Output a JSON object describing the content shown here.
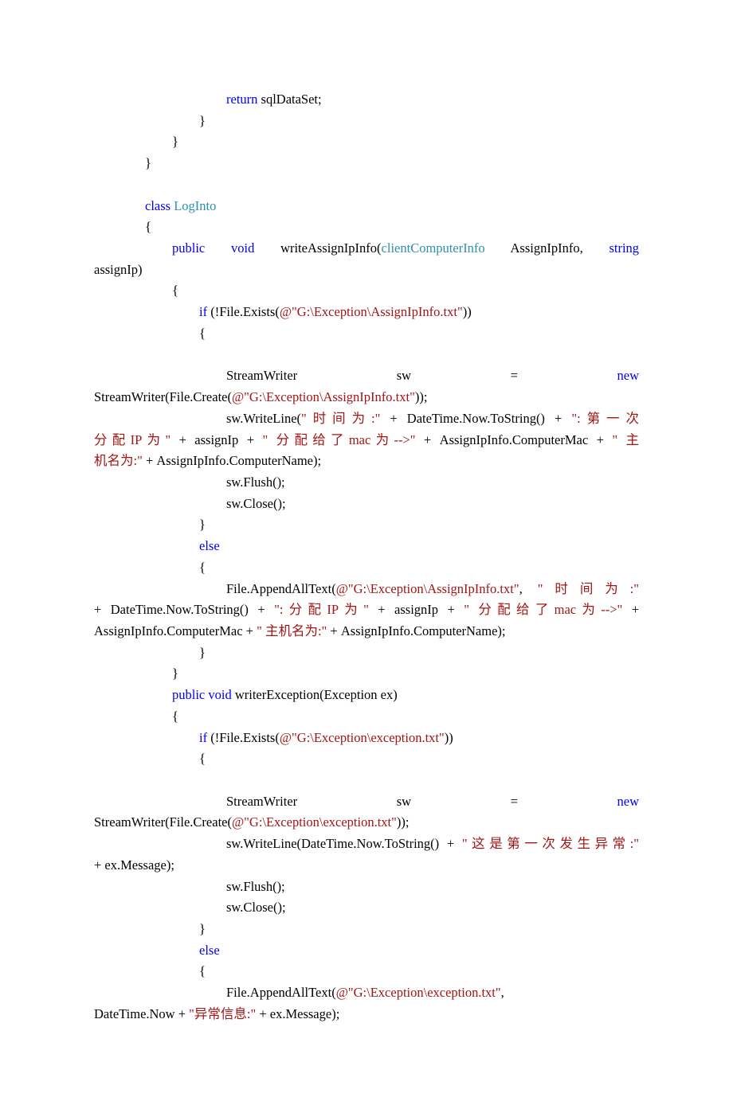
{
  "code": {
    "l1": "return",
    "l1b": " sqlDataSet;",
    "l2": "}",
    "l3": "}",
    "l4": "}",
    "l5a": "class",
    "l5b": " ",
    "l5c": "LogInto",
    "l6": "{",
    "l7a": "public",
    "l7b": "void",
    "l7c": "writeAssignIpInfo(",
    "l7d": "clientComputerInfo",
    "l7e": "AssignIpInfo,",
    "l7f": "string",
    "l8a": "assignIp)",
    "l9": "{",
    "l10a": "if",
    "l10b": " (!File.Exists(",
    "l10c": "@\"G:\\Exception\\AssignIpInfo.txt\"",
    "l10d": "))",
    "l11": "{",
    "l12a": "StreamWriter",
    "l12b": "sw",
    "l12c": "=",
    "l12d": "new",
    "l13a": "StreamWriter(File.Create(",
    "l13b": "@\"G:\\Exception\\AssignIpInfo.txt\"",
    "l13c": "));",
    "l14a": "sw.WriteLine(",
    "l14b": "\"时间为:\"",
    "l14c": " + DateTime.Now.ToString() + ",
    "l14d": "\":第一次",
    "l15a": "分配IP为\"",
    "l15b": " + assignIp + ",
    "l15c": "\"  分配给了mac为-->\"",
    "l15d": " + AssignIpInfo.ComputerMac + ",
    "l15e": "\"   主",
    "l16a": "机名为:\"",
    "l16b": " + AssignIpInfo.ComputerName);",
    "l17": "sw.Flush();",
    "l18": "sw.Close();",
    "l19": "}",
    "l20": "else",
    "l21": "{",
    "l22a": "File.AppendAllText(",
    "l22b": "@\"G:\\Exception\\AssignIpInfo.txt\"",
    "l22c": ", ",
    "l22d": "\"时间为:\"",
    "l23a": "+ DateTime.Now.ToString() + ",
    "l23b": "\":分配IP为\"",
    "l23c": " + assignIp + ",
    "l23d": "\"  分配给了mac为-->\"",
    "l23e": " + ",
    "l24a": "AssignIpInfo.ComputerMac + ",
    "l24b": "\"   主机名为:\"",
    "l24c": " + AssignIpInfo.ComputerName);",
    "l25": "}",
    "l26": "}",
    "l27a": "public",
    "l27b": " ",
    "l27c": "void",
    "l27d": " writerException(Exception ex)",
    "l28": "{",
    "l29a": "if",
    "l29b": " (!File.Exists(",
    "l29c": "@\"G:\\Exception\\exception.txt\"",
    "l29d": "))",
    "l30": "{",
    "l31a": "StreamWriter",
    "l31b": "sw",
    "l31c": "=",
    "l31d": "new",
    "l32a": "StreamWriter(File.Create(",
    "l32b": "@\"G:\\Exception\\exception.txt\"",
    "l32c": "));",
    "l33a": "sw.WriteLine(DateTime.Now.ToString() + ",
    "l33b": "\"这是第一次发生异常:\"",
    "l34a": "+ ex.Message);",
    "l35": "sw.Flush();",
    "l36": "sw.Close();",
    "l37": "}",
    "l38": "else",
    "l39": "{",
    "l40a": "File.AppendAllText(",
    "l40b": "@\"G:\\Exception\\exception.txt\"",
    "l40c": ", ",
    "l41a": "DateTime.Now + ",
    "l41b": "\"异常信息:\"",
    "l41c": " + ex.Message);"
  }
}
